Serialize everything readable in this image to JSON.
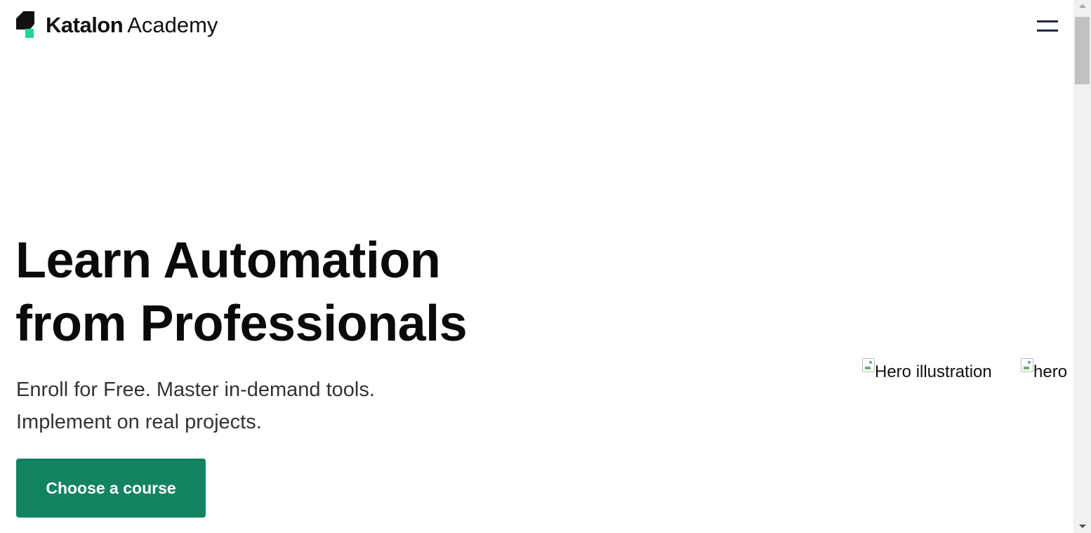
{
  "header": {
    "brand": "Katalon",
    "brand_sub": "Academy",
    "menu_icon": "hamburger-menu-icon"
  },
  "hero": {
    "title_line1": "Learn Automation",
    "title_line2": "from Professionals",
    "subtitle_line1": "Enroll for Free. Master in-demand tools.",
    "subtitle_line2": "Implement on real projects.",
    "cta_label": "Choose a course",
    "image1_alt": "Hero illustration",
    "image2_alt": "hero"
  },
  "colors": {
    "accent": "#138461",
    "logo_green": "#21d598",
    "menu_lines": "#1b2740"
  }
}
